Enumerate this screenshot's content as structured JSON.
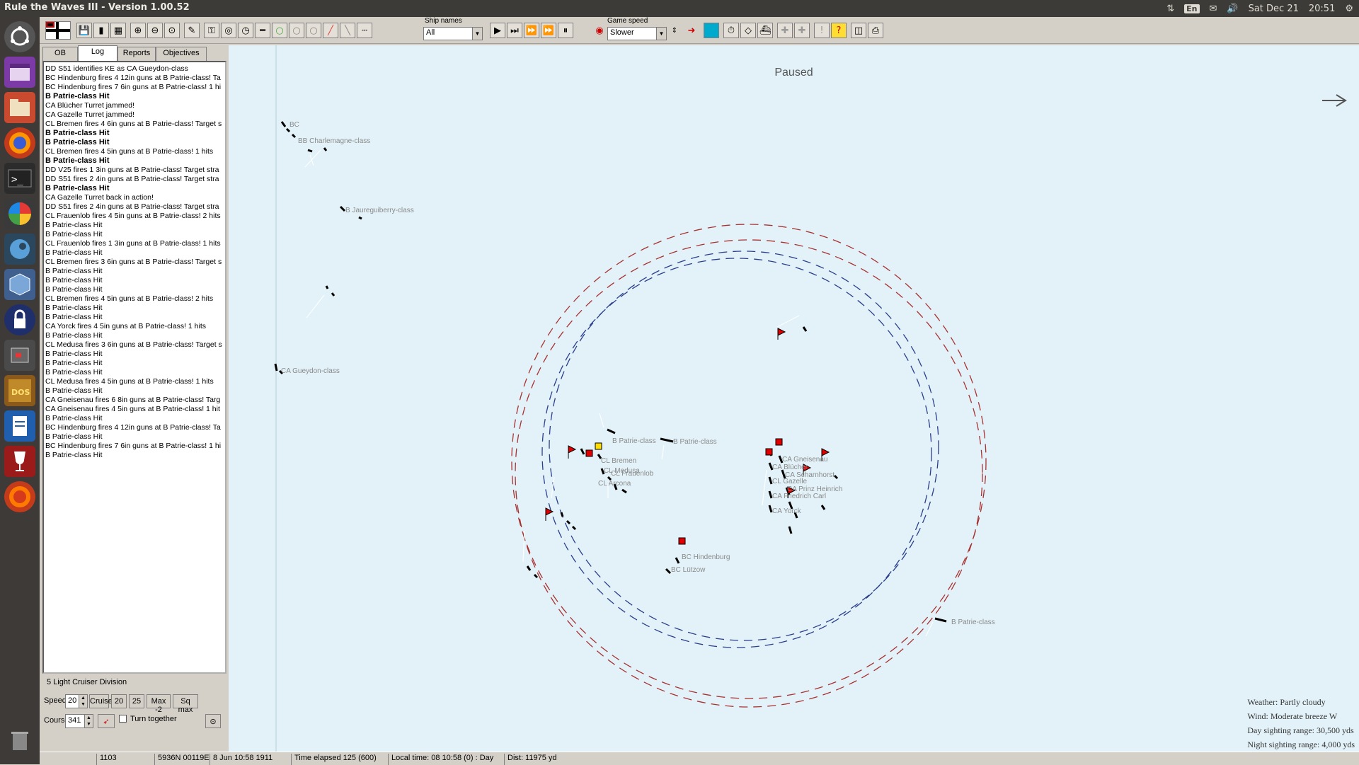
{
  "topbar": {
    "window_title": "Rule the Waves III - Version 1.00.52",
    "language": "En",
    "date": "Sat Dec 21",
    "time": "20:51"
  },
  "launcher": {
    "items": [
      "ubuntu-dash",
      "files-panel",
      "file-manager",
      "firefox",
      "terminal",
      "pinwheel-app",
      "steam",
      "virtualbox",
      "lock-app",
      "window-app",
      "dosbox",
      "text-editor",
      "wine",
      "firefox-2",
      "trash"
    ]
  },
  "toolbar": {
    "ship_names_label": "Ship names",
    "ship_names_value": "All",
    "game_speed_label": "Game speed",
    "game_speed_value": "Slower"
  },
  "tabs": [
    "OB",
    "Log",
    "Reports",
    "Objectives"
  ],
  "active_tab": "Log",
  "log": [
    {
      "text": "DD S51 identifies KE as CA Gueydon-class",
      "bold": false
    },
    {
      "text": "BC Hindenburg fires 4 12in guns at B Patrie-class! Ta",
      "bold": false
    },
    {
      "text": "BC Hindenburg fires 7 6in guns at B Patrie-class! 1 hi",
      "bold": false
    },
    {
      "text": "B Patrie-class Hit",
      "bold": true
    },
    {
      "text": "CA Blücher Turret jammed!",
      "bold": false
    },
    {
      "text": "CA Gazelle Turret jammed!",
      "bold": false
    },
    {
      "text": "CL Bremen fires 4 6in guns at B Patrie-class! Target s",
      "bold": false
    },
    {
      "text": "B Patrie-class Hit",
      "bold": true
    },
    {
      "text": "B Patrie-class Hit",
      "bold": true
    },
    {
      "text": "CL Bremen fires 4 5in guns at B Patrie-class! 1 hits",
      "bold": false
    },
    {
      "text": "B Patrie-class Hit",
      "bold": true
    },
    {
      "text": "DD V25 fires 1 3in guns at B Patrie-class! Target stra",
      "bold": false
    },
    {
      "text": "DD S51 fires 2 4in guns at B Patrie-class! Target stra",
      "bold": false
    },
    {
      "text": "B Patrie-class Hit",
      "bold": true
    },
    {
      "text": "CA Gazelle Turret back in action!",
      "bold": false
    },
    {
      "text": "DD S51 fires 2 4in guns at B Patrie-class! Target stra",
      "bold": false
    },
    {
      "text": "CL Frauenlob fires 4 5in guns at B Patrie-class! 2 hits",
      "bold": false
    },
    {
      "text": "B Patrie-class Hit",
      "bold": false
    },
    {
      "text": "B Patrie-class Hit",
      "bold": false
    },
    {
      "text": "CL Frauenlob fires 1 3in guns at B Patrie-class! 1 hits",
      "bold": false
    },
    {
      "text": "B Patrie-class Hit",
      "bold": false
    },
    {
      "text": "CL Bremen fires 3 6in guns at B Patrie-class! Target s",
      "bold": false
    },
    {
      "text": "B Patrie-class Hit",
      "bold": false
    },
    {
      "text": "B Patrie-class Hit",
      "bold": false
    },
    {
      "text": "B Patrie-class Hit",
      "bold": false
    },
    {
      "text": "CL Bremen fires 4 5in guns at B Patrie-class! 2 hits",
      "bold": false
    },
    {
      "text": "B Patrie-class Hit",
      "bold": false
    },
    {
      "text": "B Patrie-class Hit",
      "bold": false
    },
    {
      "text": "CA Yorck fires 4 5in guns at B Patrie-class! 1 hits",
      "bold": false
    },
    {
      "text": "B Patrie-class Hit",
      "bold": false
    },
    {
      "text": "CL Medusa fires 3 6in guns at B Patrie-class! Target s",
      "bold": false
    },
    {
      "text": "B Patrie-class Hit",
      "bold": false
    },
    {
      "text": "B Patrie-class Hit",
      "bold": false
    },
    {
      "text": "B Patrie-class Hit",
      "bold": false
    },
    {
      "text": "CL Medusa fires 4 5in guns at B Patrie-class! 1 hits",
      "bold": false
    },
    {
      "text": "B Patrie-class Hit",
      "bold": false
    },
    {
      "text": "CA Gneisenau fires 6 8in guns at B Patrie-class! Targ",
      "bold": false
    },
    {
      "text": "CA Gneisenau fires 4 5in guns at B Patrie-class! 1 hit",
      "bold": false
    },
    {
      "text": "B Patrie-class Hit",
      "bold": false
    },
    {
      "text": "BC Hindenburg fires 4 12in guns at B Patrie-class! Ta",
      "bold": false
    },
    {
      "text": "B Patrie-class Hit",
      "bold": false
    },
    {
      "text": "BC Hindenburg fires 7 6in guns at B Patrie-class! 1 hi",
      "bold": false
    },
    {
      "text": "B Patrie-class Hit",
      "bold": false
    }
  ],
  "controls": {
    "division": "5 Light Cruiser Division",
    "speed_label": "Speed",
    "speed_value": "20",
    "cruise_label": "Cruise",
    "speed_20_label": "20",
    "speed_25_label": "25",
    "max2_label": "Max -2",
    "sqmax_label": "Sq max",
    "course_label": "Course",
    "course_value": "341",
    "turn_together_label": "Turn together"
  },
  "map": {
    "status": "Paused",
    "ship_labels": {
      "bc": "BC",
      "charlemagne": "BB Charlemagne-class",
      "jaureguiberry": "B Jaureguiberry-class",
      "gueydon": "CA Gueydon-class",
      "patrie1": "B Patrie-class",
      "patrie2": "B Patrie-class",
      "patrie3": "B Patrie-class",
      "bremen": "CL Bremen",
      "medusa": "CL Medusa",
      "frauenlob": "CL Frauenlob",
      "arcona": "CL Arcona",
      "gneisenau": "CA Gneisenau",
      "blucher": "CA Blücher",
      "scharnhorst": "CA Scharnhorst",
      "gazelle": "CL Gazelle",
      "prinz_heinrich": "CA Prinz Heinrich",
      "friedrich_carl": "CA Friedrich Carl",
      "yorck": "CA Yorck",
      "hindenburg": "BC Hindenburg",
      "lutzow": "BC Lützow"
    },
    "colors": {
      "sea": "#e2f2f8",
      "red_range": "#a83232",
      "blue_range": "#2b3e8c",
      "flag": "#e00000"
    }
  },
  "weather": {
    "weather": "Weather: Partly cloudy",
    "wind": "Wind: Moderate breeze  W",
    "day_sighting": "Day sighting range: 30,500 yds",
    "night_sighting": "Night sighting range: 4,000 yds"
  },
  "statusbar": {
    "grid": "1103",
    "position": "5936N 00119E",
    "date": "8 Jun 10:58 1911",
    "elapsed": "Time elapsed 125 (600)",
    "local_time": "Local time: 08 10:58 (0) : Day",
    "distance": "Dist: 11975 yd"
  }
}
